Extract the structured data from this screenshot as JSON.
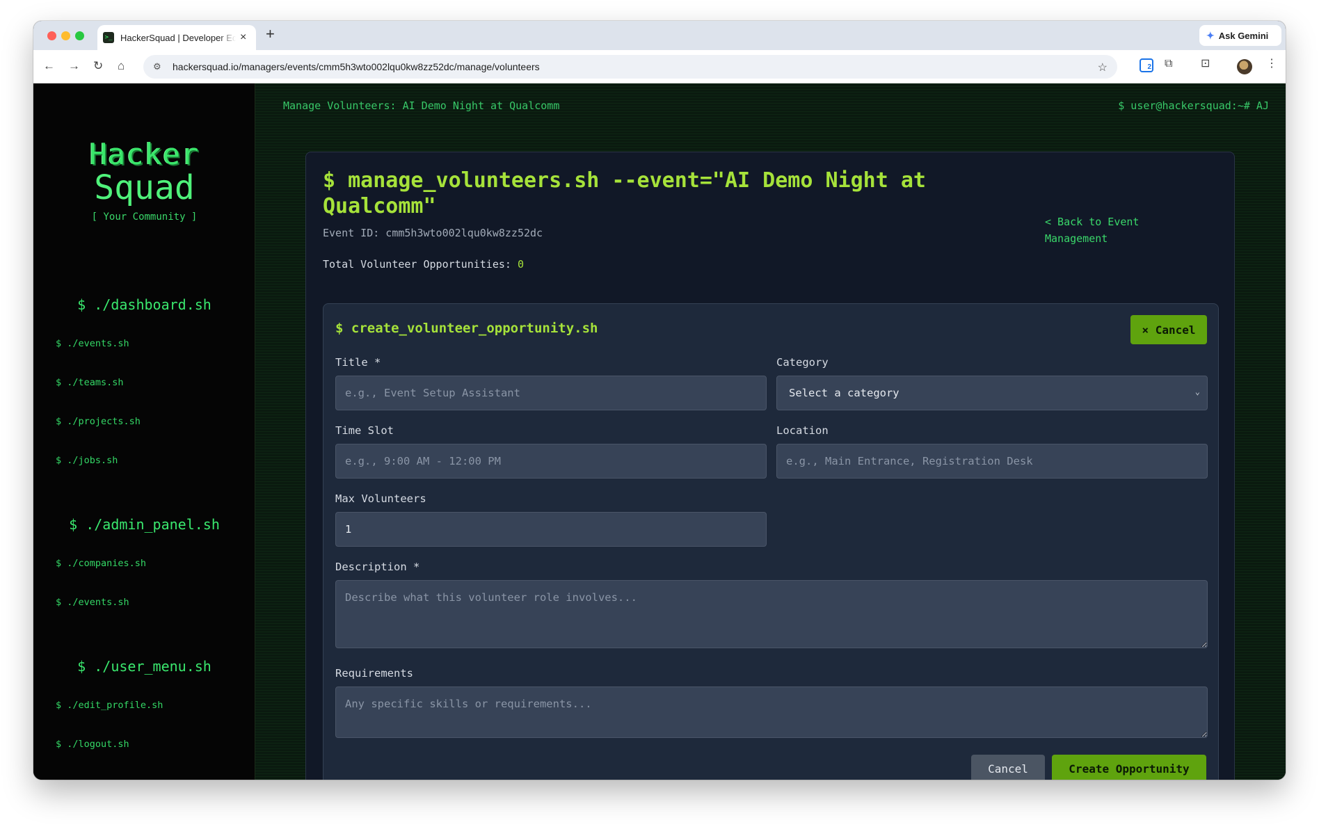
{
  "browser": {
    "tab_title": "HackerSquad | Developer Ecosystem",
    "tab_favicon": ">_",
    "new_tab": "+",
    "close_tab": "×",
    "gemini_label": "Ask Gemini",
    "url": "hackersquad.io/managers/events/cmm5h3wto002lqu0kw8zz52dc/manage/volunteers",
    "extension_badge": "2"
  },
  "sidebar": {
    "logo_hacker": "Hacker",
    "logo_squad": "Squad",
    "logo_sub": "[ Your Community ]",
    "sections": [
      {
        "header": "$ ./dashboard.sh",
        "items": [
          "$ ./events.sh",
          "$ ./teams.sh",
          "$ ./projects.sh",
          "$ ./jobs.sh"
        ]
      },
      {
        "header": "$ ./admin_panel.sh",
        "items": [
          "$ ./companies.sh",
          "$ ./events.sh"
        ]
      },
      {
        "header": "$ ./user_menu.sh",
        "items": [
          "$ ./edit_profile.sh",
          "$ ./logout.sh"
        ]
      }
    ]
  },
  "topbar": {
    "left": "Manage Volunteers: AI Demo Night at Qualcomm",
    "right": "$ user@hackersquad:~# AJ"
  },
  "panel": {
    "title": "$ manage_volunteers.sh --event=\"AI Demo Night at Qualcomm\"",
    "event_id": "Event ID: cmm5h3wto002lqu0kw8zz52dc",
    "back_link": "< Back to Event Management",
    "total_label": "Total Volunteer Opportunities:",
    "total_count": "0"
  },
  "form": {
    "title": "$ create_volunteer_opportunity.sh",
    "cancel_top": "× Cancel",
    "title_label": "Title *",
    "title_placeholder": "e.g., Event Setup Assistant",
    "category_label": "Category",
    "category_value": "Select a category",
    "timeslot_label": "Time Slot",
    "timeslot_placeholder": "e.g., 9:00 AM - 12:00 PM",
    "location_label": "Location",
    "location_placeholder": "e.g., Main Entrance, Registration Desk",
    "max_label": "Max Volunteers",
    "max_value": "1",
    "description_label": "Description *",
    "description_placeholder": "Describe what this volunteer role involves...",
    "requirements_label": "Requirements",
    "requirements_placeholder": "Any specific skills or requirements...",
    "cancel_label": "Cancel",
    "create_label": "Create Opportunity"
  },
  "colors": {
    "accent_green": "#a6e23a",
    "terminal_green": "#39e66a",
    "button_green": "#5fa30e",
    "panel_bg": "#111827",
    "card_bg": "#1e293b"
  }
}
